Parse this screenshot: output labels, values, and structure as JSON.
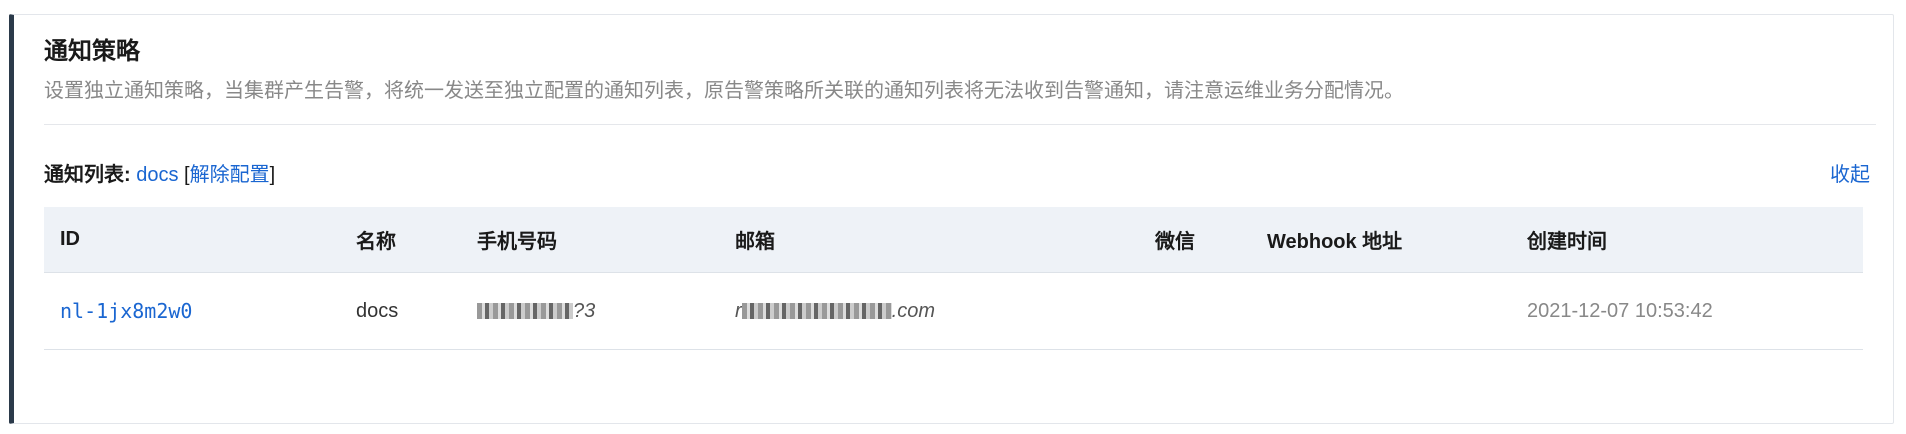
{
  "section": {
    "title": "通知策略",
    "description": "设置独立通知策略，当集群产生告警，将统一发送至独立配置的通知列表，原告警策略所关联的通知列表将无法收到告警通知，请注意运维业务分配情况。"
  },
  "notify_list": {
    "label": "通知列表:",
    "name": "docs",
    "bracket_open": "[",
    "action": "解除配置",
    "bracket_close": "]",
    "collapse": "收起"
  },
  "table": {
    "columns": [
      "ID",
      "名称",
      "手机号码",
      "邮箱",
      "微信",
      "Webhook 地址",
      "创建时间"
    ],
    "rows": [
      {
        "id": "nl-1jx8m2w0",
        "name": "docs",
        "phone_suffix": "?3",
        "email_prefix": "r",
        "email_suffix": ".com",
        "wechat": "",
        "webhook": "",
        "created": "2021-12-07 10:53:42"
      }
    ]
  }
}
